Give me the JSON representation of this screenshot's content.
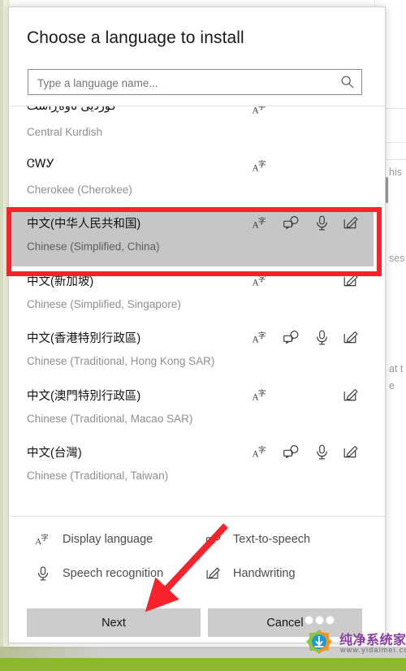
{
  "dialog": {
    "title": "Choose a language to install",
    "search": {
      "placeholder": "Type a language name...",
      "value": "",
      "icon": "search-icon"
    },
    "languages": [
      {
        "native": "کوردیی ناوەڕاست",
        "english": "Central Kurdish",
        "rtl": true,
        "selected": false,
        "features": [
          "display-language"
        ]
      },
      {
        "native": "ᏣᎳᎩ",
        "english": "Cherokee (Cherokee)",
        "rtl": false,
        "selected": false,
        "features": [
          "display-language"
        ]
      },
      {
        "native": "中文(中华人民共和国)",
        "english": "Chinese (Simplified, China)",
        "rtl": false,
        "selected": true,
        "features": [
          "display-language",
          "text-to-speech",
          "speech-recognition",
          "handwriting"
        ]
      },
      {
        "native": "中文(新加坡)",
        "english": "Chinese (Simplified, Singapore)",
        "rtl": false,
        "selected": false,
        "features": [
          "display-language",
          "handwriting"
        ]
      },
      {
        "native": "中文(香港特別行政區)",
        "english": "Chinese (Traditional, Hong Kong SAR)",
        "rtl": false,
        "selected": false,
        "features": [
          "display-language",
          "text-to-speech",
          "speech-recognition",
          "handwriting"
        ]
      },
      {
        "native": "中文(澳門特別行政區)",
        "english": "Chinese (Traditional, Macao SAR)",
        "rtl": false,
        "selected": false,
        "features": [
          "display-language",
          "handwriting"
        ]
      },
      {
        "native": "中文(台灣)",
        "english": "Chinese (Traditional, Taiwan)",
        "rtl": false,
        "selected": false,
        "features": [
          "display-language",
          "text-to-speech",
          "speech-recognition",
          "handwriting"
        ]
      }
    ],
    "legend": [
      {
        "icon": "display-language-icon",
        "label": "Display language"
      },
      {
        "icon": "text-to-speech-icon",
        "label": "Text-to-speech"
      },
      {
        "icon": "speech-recognition-icon",
        "label": "Speech recognition"
      },
      {
        "icon": "handwriting-icon",
        "label": "Handwriting"
      }
    ],
    "buttons": {
      "next": "Next",
      "cancel": "Cancel"
    }
  },
  "annotations": {
    "highlight_color": "#f8222a",
    "arrow_color": "#f8222a",
    "highlight_target": "中文(中华人民共和国)",
    "arrow_target": "Next"
  },
  "background": {
    "fragments": [
      "his",
      "ses",
      "at t",
      "e"
    ]
  },
  "watermark": {
    "site_name": "纯净系统家园",
    "url": "www.yidaimei.com"
  }
}
